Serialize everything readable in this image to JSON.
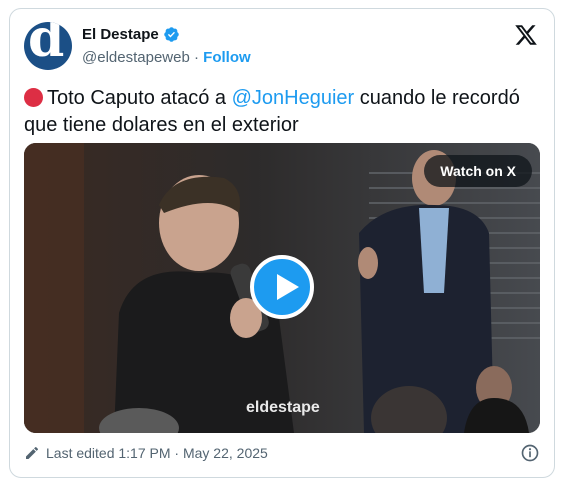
{
  "account": {
    "name": "El Destape",
    "handle": "@eldestapeweb",
    "separator": "·",
    "follow_label": "Follow",
    "avatar_letter": "d"
  },
  "tweet": {
    "text_before": "Toto Caputo atacó a ",
    "mention": "@JonHeguier",
    "text_after": " cuando le recordó que tiene dolares en el exterior"
  },
  "video": {
    "watch_label": "Watch on X",
    "watermark": "eldestape"
  },
  "footer": {
    "edited_label": "Last edited 1:17 PM · May 22, 2025"
  },
  "colors": {
    "accent": "#1d9bf0",
    "brand": "#1b4f86",
    "red_dot": "#dd2e44"
  }
}
